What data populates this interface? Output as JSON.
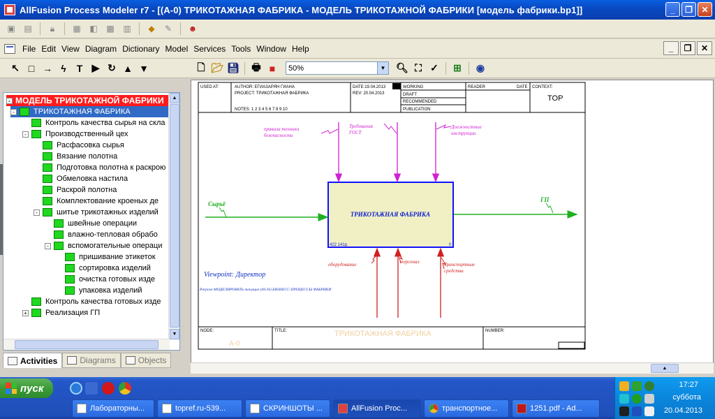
{
  "window": {
    "title": "AllFusion Process Modeler r7 - [(A-0) ТРИКОТАЖНАЯ ФАБРИКА - МОДЕЛЬ ТРИКОТАЖНОЙ ФАБРИКИ  [модель фабрики.bp1]]",
    "minimize": "_",
    "maximize": "❐",
    "close": "✕"
  },
  "menu": {
    "items": [
      "File",
      "Edit",
      "View",
      "Diagram",
      "Dictionary",
      "Model",
      "Services",
      "Tools",
      "Window",
      "Help"
    ],
    "mdi_minimize": "_",
    "mdi_restore": "❐",
    "mdi_close": "✕"
  },
  "toolbar": {
    "zoom_value": "50%",
    "zoom_arrow": "▼"
  },
  "tree": {
    "root": "МОДЕЛЬ ТРИКОТАЖНОЙ ФАБРИКИ",
    "items": [
      {
        "label": "ТРИКОТАЖНАЯ ФАБРИКА"
      },
      {
        "label": "Контроль качества  сырья на скла"
      },
      {
        "label": "Производственный цех"
      },
      {
        "label": "Расфасовка  сырья"
      },
      {
        "label": "Вязание полотна"
      },
      {
        "label": "Подготовка  полотна к раскрою"
      },
      {
        "label": "Обмеловка  настила"
      },
      {
        "label": "Раскрой полотна"
      },
      {
        "label": "Комплектование  кроеных   де"
      },
      {
        "label": "шитье  трикотажных изделий"
      },
      {
        "label": "швейные операции"
      },
      {
        "label": "влажно-тепловая      обрабо"
      },
      {
        "label": "вспомогательные  операци"
      },
      {
        "label": "пришивание  этикеток"
      },
      {
        "label": "сортировка  изделий"
      },
      {
        "label": "очистка готовых     изде"
      },
      {
        "label": "упаковка изделий"
      },
      {
        "label": "Контроль качества  готовых изде"
      },
      {
        "label": "Реализация ГП"
      }
    ],
    "expanders": [
      "-",
      "-",
      "-",
      "-",
      "-",
      "+"
    ],
    "scroll_up": "▲",
    "scroll_down": "▼"
  },
  "explorer_tabs": {
    "activities": "Activities",
    "diagrams": "Diagrams",
    "objects": "Objects"
  },
  "diagram": {
    "header": {
      "used_at": "USED AT:",
      "author": "AUTHOR:  ЕГИАЗАРЯН ГИАНА",
      "project": "PROJECT:  ТРИКОТАЖНАЯ ФАБРИКА",
      "notes": "NOTES:  1  2  3  4  5  6  7  8  9  10",
      "date": "DATE:19.04.2013",
      "rev": "REV:  20.04.2013",
      "working": "WORKING",
      "draft": "DRAFT",
      "recommended": "RECOMMENDED",
      "publication": "PUBLICATION",
      "reader": "READER",
      "date2": "DATE",
      "context": "CONTEXT:",
      "top": "TOP"
    },
    "box": {
      "title": "ТРИКОТАЖНАЯ ФАБРИКА",
      "cost": "422 141р.",
      "number": "0"
    },
    "arrows": {
      "input": "Сырьё",
      "output": "ГП",
      "control1_line1": "правила техники",
      "control1_line2": "безопасности",
      "control2_line1": "Требования",
      "control2_line2": "ГОСТ",
      "control3_line1": "Должностные",
      "control3_line2": "инструкции",
      "mech1": "оборудование",
      "mech2": "персонал",
      "mech3_line1": "Транспортные",
      "mech3_line2": "средства"
    },
    "viewpoint": "Viewpoint: Директор",
    "purpose": "Purpose:МОДЕЛИРОВАТЬ текущие (AS-IS) БИЗНЕСС-ПРОЦЕССЫ ФАБРИКИ",
    "footer": {
      "node": "NODE:",
      "node_value": "A-0",
      "title": "TITLE:",
      "title_value": "ТРИКОТАЖНАЯ ФАБРИКА",
      "number": "NUMBER:"
    }
  },
  "taskbar": {
    "start": "пуск",
    "tasks": [
      "Лабораторны...",
      "topref.ru-539...",
      "СКРИНШОТЫ ...",
      "AllFusion Proc...",
      "транспортное...",
      "1251.pdf - Ad..."
    ],
    "time": "17:27",
    "day": "суббота",
    "date": "20.04.2013"
  }
}
